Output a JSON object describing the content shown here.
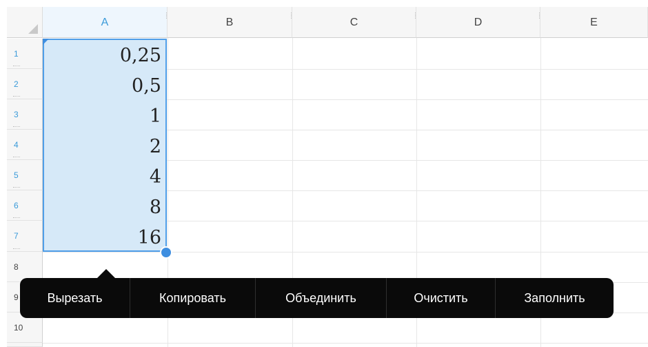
{
  "columns": [
    "A",
    "B",
    "C",
    "D",
    "E"
  ],
  "rows": [
    "1",
    "2",
    "3",
    "4",
    "5",
    "6",
    "7",
    "8",
    "9",
    "10"
  ],
  "cells": {
    "A1": "0,25",
    "A2": "0,5",
    "A3": "1",
    "A4": "2",
    "A5": "4",
    "A6": "8",
    "A7": "16"
  },
  "selection": {
    "range": "A1:A7",
    "active_column": "A"
  },
  "context_menu": {
    "items": [
      "Вырезать",
      "Копировать",
      "Объединить",
      "Очистить",
      "Заполнить"
    ]
  },
  "colors": {
    "accent": "#3e8ee0",
    "selection_fill": "#d6e9f8",
    "menu_background": "#0a0a0a",
    "menu_text": "#ffffff"
  }
}
